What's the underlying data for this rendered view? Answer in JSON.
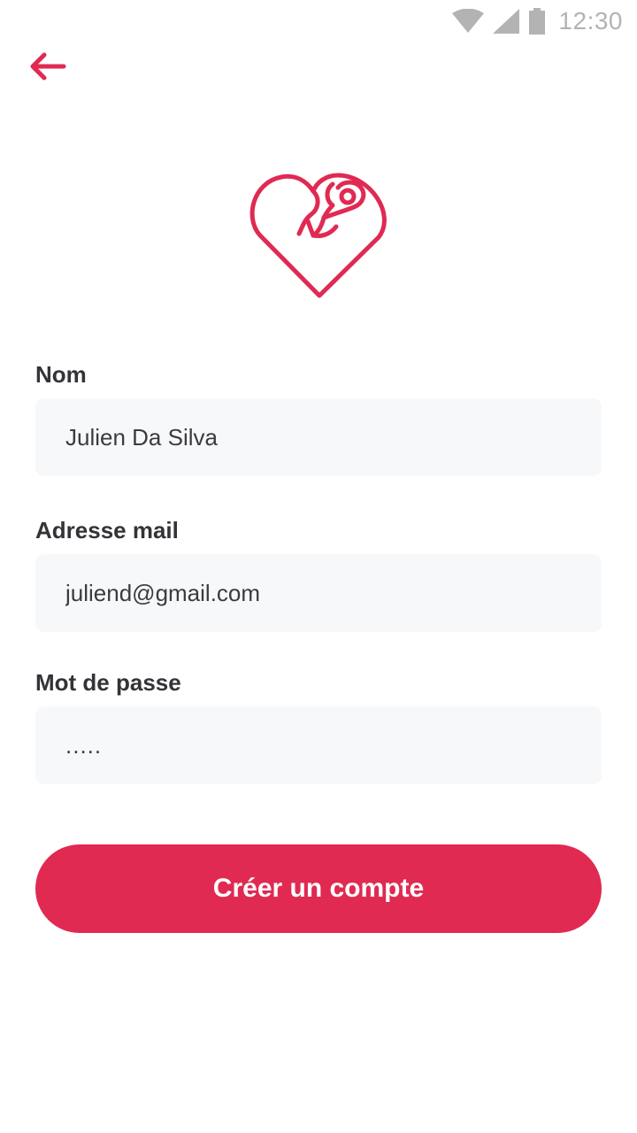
{
  "status_bar": {
    "time": "12:30",
    "icons": [
      "wifi-icon",
      "cell-signal-icon",
      "battery-icon"
    ],
    "icon_color": "#b3b3b3"
  },
  "header": {
    "back_icon": "arrow-left-icon"
  },
  "logo": {
    "icon": "heart-mother-child-logo",
    "color": "#e02a52"
  },
  "form": {
    "name": {
      "label": "Nom",
      "value": "Julien Da Silva"
    },
    "email": {
      "label": "Adresse mail",
      "value": "juliend@gmail.com"
    },
    "password": {
      "label": "Mot de passe",
      "value": "....."
    }
  },
  "actions": {
    "create_account_label": "Créer un compte"
  },
  "colors": {
    "accent": "#e02a52",
    "field_background": "#f7f8fa",
    "text": "#333338"
  }
}
